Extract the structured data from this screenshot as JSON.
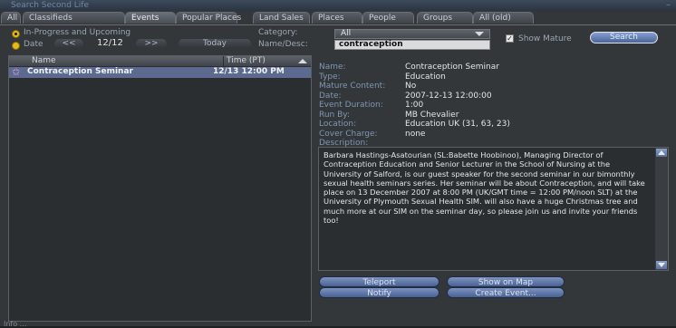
{
  "window": {
    "title": "Search Second Life",
    "close": "–"
  },
  "tabs": [
    {
      "label": "All"
    },
    {
      "label": "Classifieds"
    },
    {
      "label": "Events"
    },
    {
      "label": "Popular Places"
    },
    {
      "label": "Land Sales"
    },
    {
      "label": "Places"
    },
    {
      "label": "People"
    },
    {
      "label": "Groups"
    },
    {
      "label": "All (old)"
    }
  ],
  "filters": {
    "in_progress_label": "In-Progress and Upcoming",
    "date_label": "Date",
    "prev": "<<",
    "date_value": "12/12",
    "next": ">>",
    "today": "Today",
    "category_label": "Category:",
    "category_value": "All",
    "name_desc_label": "Name/Desc:",
    "name_desc_value": "contraception",
    "show_mature_label": "Show Mature",
    "search_button": "Search"
  },
  "list": {
    "columns": [
      "Name",
      "Time (PT)"
    ],
    "rows": [
      {
        "name": "Contraception Seminar",
        "time": "12/13 12:00 PM"
      }
    ]
  },
  "details": {
    "name_label": "Name:",
    "name_value": "Contraception Seminar",
    "type_label": "Type:",
    "type_value": "Education",
    "mature_label": "Mature Content:",
    "mature_value": "No",
    "date_label": "Date:",
    "date_value": "2007-12-13 12:00:00",
    "duration_label": "Event Duration:",
    "duration_value": "1:00",
    "runby_label": "Run By:",
    "runby_value": "MB Chevalier",
    "location_label": "Location:",
    "location_value": "Education UK (31, 63, 23)",
    "cover_label": "Cover Charge:",
    "cover_value": "none",
    "description_label": "Description:",
    "description": "Barbara Hastings-Asatourian (SL:Babette Hoobinoo), Managing Director of Contraception Education and Senior Lecturer in the School of Nursing at the University of Salford, is our guest speaker for the second seminar in our bimonthly sexual health seminars series. Her seminar will be about Contraception, and will take place on 13 December 2007 at 8:00 PM (UK/GMT time = 12:00 PM/noon SLT) at the University of Plymouth Sexual Health SIM. will also have a huge Christmas tree and much more at our SIM on the seminar day, so please join us and invite your friends too!"
  },
  "buttons": {
    "teleport": "Teleport",
    "show_on_map": "Show on Map",
    "notify": "Notify",
    "create_event": "Create Event..."
  },
  "status": "Info ..."
}
